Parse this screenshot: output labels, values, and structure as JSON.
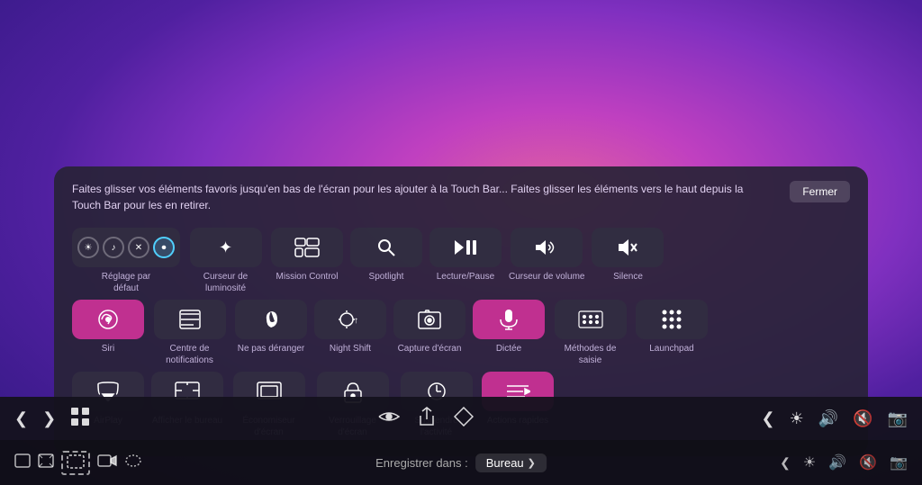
{
  "background": {
    "gradient": "radial-gradient purple-pink macOS"
  },
  "panel": {
    "instruction": "Faites glisser vos éléments favoris jusqu'en bas de l'écran pour les ajouter à la Touch Bar... Faites glisser les éléments vers le haut depuis la Touch Bar pour les en retirer.",
    "close_button": "Fermer"
  },
  "items": {
    "row1": [
      {
        "id": "reglage-par-defaut",
        "label": "Réglage par défaut",
        "icon": "multi",
        "wide": true
      },
      {
        "id": "curseur-luminosite",
        "label": "Curseur de luminosité",
        "icon": "brightness"
      },
      {
        "id": "mission-control",
        "label": "Mission Control",
        "icon": "mission"
      },
      {
        "id": "spotlight",
        "label": "Spotlight",
        "icon": "spotlight"
      },
      {
        "id": "lecture-pause",
        "label": "Lecture/Pause",
        "icon": "play-pause"
      },
      {
        "id": "curseur-volume",
        "label": "Curseur de volume",
        "icon": "volume"
      },
      {
        "id": "silence",
        "label": "Silence",
        "icon": "silence"
      }
    ],
    "row2": [
      {
        "id": "siri",
        "label": "Siri",
        "icon": "siri",
        "pink": true
      },
      {
        "id": "centre-notifications",
        "label": "Centre de notifications",
        "icon": "notif"
      },
      {
        "id": "ne-pas-deranger",
        "label": "Ne pas déranger",
        "icon": "dnd"
      },
      {
        "id": "night-shift",
        "label": "Night Shift",
        "icon": "nightshift"
      },
      {
        "id": "capture-ecran",
        "label": "Capture d'écran",
        "icon": "camera"
      },
      {
        "id": "dictee",
        "label": "Dictée",
        "icon": "mic",
        "pink": true
      },
      {
        "id": "methodes-saisie",
        "label": "Méthodes de saisie",
        "icon": "keyboard"
      },
      {
        "id": "launchpad",
        "label": "Launchpad",
        "icon": "launchpad"
      }
    ],
    "row3": [
      {
        "id": "airplay",
        "label": "AirPlay",
        "icon": "airplay"
      },
      {
        "id": "afficher-bureau",
        "label": "Afficher le bureau",
        "icon": "desktop"
      },
      {
        "id": "economiseur-ecran",
        "label": "Économiseur d'écran",
        "icon": "screensaver"
      },
      {
        "id": "verrouillage-ecran",
        "label": "Verrouillage d'écran",
        "icon": "lock"
      },
      {
        "id": "suspendre-activite",
        "label": "Suspendre l'activité",
        "icon": "sleep"
      },
      {
        "id": "actions-rapides",
        "label": "Actions rapides",
        "icon": "quickactions",
        "pink": true
      }
    ]
  },
  "toolbar": {
    "chevron_left": "❮",
    "chevron_right": "❯",
    "grid": "⊞",
    "eye": "◉",
    "share": "⬆",
    "tag": "⬡",
    "chevron_left2": "❮",
    "brightness": "☀",
    "volume": "🔊",
    "mute": "🔇",
    "camera": "📷"
  },
  "statusbar": {
    "save_label": "Enregistrer dans :",
    "save_dest": "Bureau",
    "chevron": "❯",
    "icons": [
      "window",
      "full-window",
      "selection",
      "video-capture",
      "dot-selection"
    ]
  }
}
